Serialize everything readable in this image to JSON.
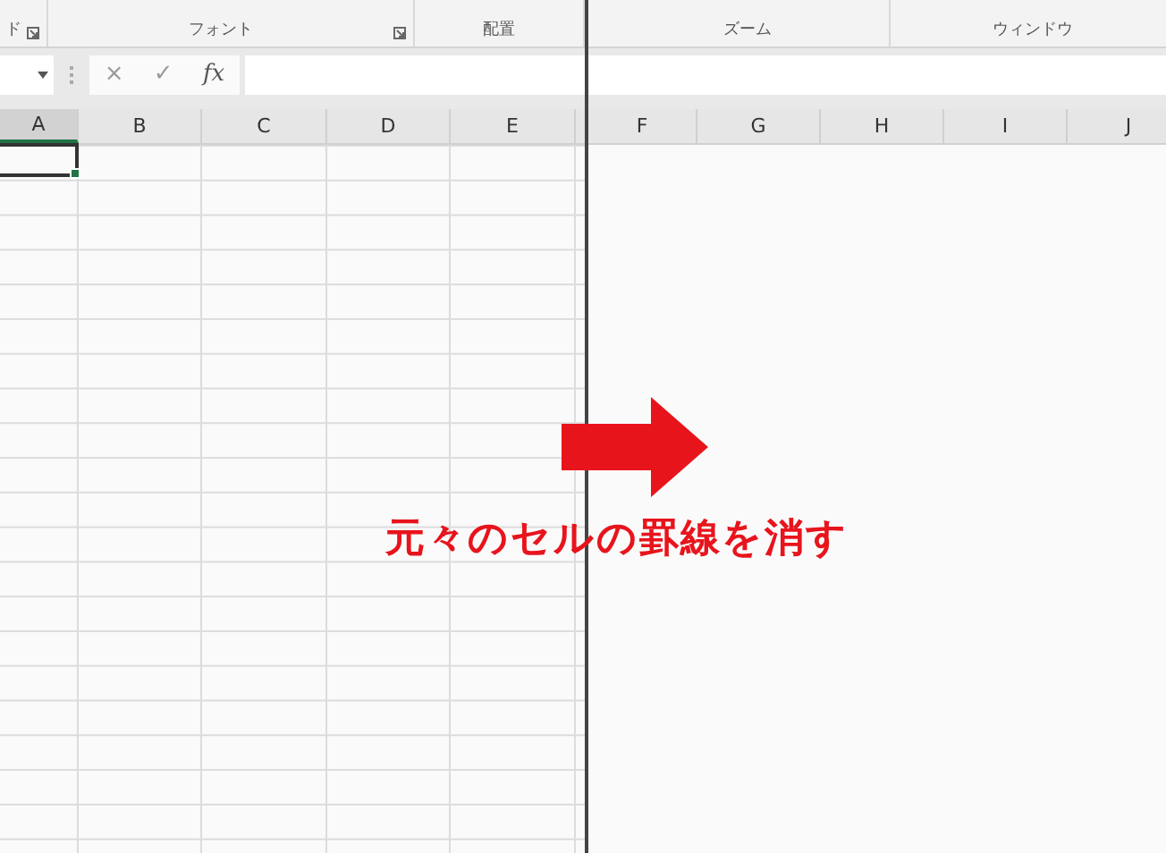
{
  "panes": [
    {
      "ribbon_groups": [
        {
          "label": "ド",
          "launcher": true
        },
        {
          "label": "フォント",
          "launcher": true
        },
        {
          "label": "配置",
          "launcher": false
        }
      ],
      "formula_bar": {
        "cancel": "×",
        "enter": "✓",
        "function": "fx"
      },
      "gridlines": true,
      "columns": [
        {
          "label": "A",
          "selected": true
        },
        {
          "label": "B",
          "selected": false
        },
        {
          "label": "C",
          "selected": false
        },
        {
          "label": "D",
          "selected": false
        },
        {
          "label": "E",
          "selected": false
        }
      ]
    },
    {
      "ribbon_groups": [
        {
          "label": "ズーム",
          "launcher": false
        },
        {
          "label": "ウィンドウ",
          "launcher": false
        }
      ],
      "gridlines": false,
      "columns": [
        {
          "label": "F",
          "selected": false
        },
        {
          "label": "G",
          "selected": false
        },
        {
          "label": "H",
          "selected": false
        },
        {
          "label": "I",
          "selected": false
        },
        {
          "label": "J",
          "selected": false
        }
      ]
    }
  ],
  "annotation": {
    "text": "元々のセルの罫線を消す"
  }
}
